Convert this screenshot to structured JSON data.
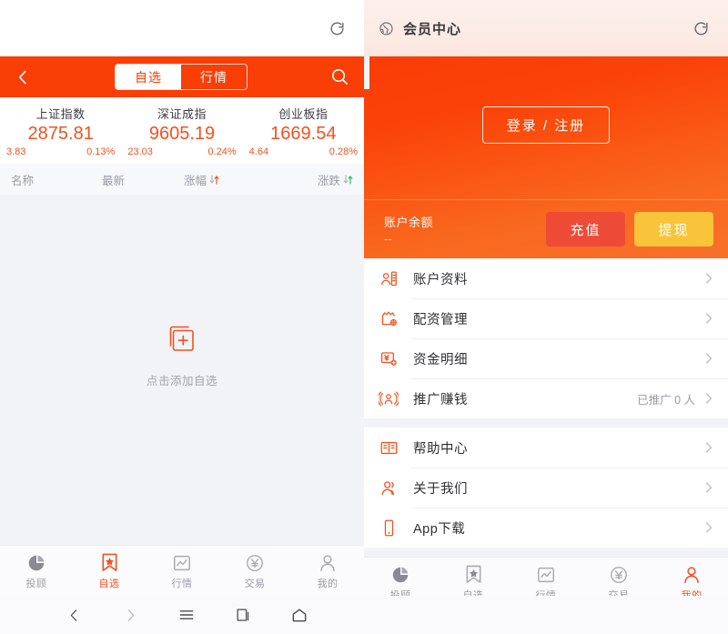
{
  "browser": {
    "left": {
      "reload_icon": "reload-icon"
    },
    "right": {
      "globe_icon": "globe-icon",
      "title": "会员中心",
      "reload_icon": "reload-icon"
    }
  },
  "left_app": {
    "header": {
      "back_icon": "chevron-left-icon",
      "search_icon": "search-icon",
      "tabs": [
        {
          "label": "自选",
          "active": true
        },
        {
          "label": "行情",
          "active": false
        }
      ]
    },
    "indices": [
      {
        "name": "上证指数",
        "value": "2875.81",
        "change": "3.83",
        "percent": "0.13%"
      },
      {
        "name": "深证成指",
        "value": "9605.19",
        "change": "23.03",
        "percent": "0.24%"
      },
      {
        "name": "创业板指",
        "value": "1669.54",
        "change": "4.64",
        "percent": "0.28%"
      }
    ],
    "table_headers": [
      {
        "label": "名称",
        "sort_icon": ""
      },
      {
        "label": "最新",
        "sort_icon": ""
      },
      {
        "label": "涨幅",
        "sort_icon": "sort-arrows-icon",
        "accent": "#f4511e"
      },
      {
        "label": "涨跌",
        "sort_icon": "sort-arrows-icon",
        "accent": "#2fbf63"
      }
    ],
    "empty_state": {
      "icon": "add-document-icon",
      "text": "点击添加自选"
    }
  },
  "right_app": {
    "hero": {
      "login_button": "登录 / 注册"
    },
    "balance": {
      "label": "账户余额",
      "value": "--",
      "recharge_button": "充值",
      "withdraw_button": "提现"
    },
    "menu_groups": [
      {
        "items": [
          {
            "icon": "account-card-icon",
            "label": "账户资料",
            "extra": ""
          },
          {
            "icon": "funding-settings-icon",
            "label": "配资管理",
            "extra": ""
          },
          {
            "icon": "funds-detail-icon",
            "label": "资金明细",
            "extra": ""
          },
          {
            "icon": "promote-icon",
            "label": "推广赚钱",
            "extra": "已推广 0 人"
          }
        ]
      },
      {
        "items": [
          {
            "icon": "help-book-icon",
            "label": "帮助中心",
            "extra": ""
          },
          {
            "icon": "about-us-icon",
            "label": "关于我们",
            "extra": ""
          },
          {
            "icon": "phone-icon",
            "label": "App下载",
            "extra": ""
          }
        ]
      }
    ]
  },
  "tabbars": {
    "left": [
      {
        "icon": "pie-chart-icon",
        "label": "投顾",
        "active": false
      },
      {
        "icon": "bookmark-star-icon",
        "label": "自选",
        "active": true
      },
      {
        "icon": "quote-chart-icon",
        "label": "行情",
        "active": false
      },
      {
        "icon": "yuan-circle-icon",
        "label": "交易",
        "active": false
      },
      {
        "icon": "person-icon",
        "label": "我的",
        "active": false
      }
    ],
    "right": [
      {
        "icon": "pie-chart-icon",
        "label": "投顾",
        "active": false
      },
      {
        "icon": "bookmark-star-icon",
        "label": "自选",
        "active": false
      },
      {
        "icon": "quote-chart-icon",
        "label": "行情",
        "active": false
      },
      {
        "icon": "yuan-circle-icon",
        "label": "交易",
        "active": false
      },
      {
        "icon": "person-icon",
        "label": "我的",
        "active": true
      }
    ]
  },
  "system_nav": [
    {
      "icon": "nav-back-icon"
    },
    {
      "icon": "nav-forward-icon"
    },
    {
      "icon": "nav-menu-icon"
    },
    {
      "icon": "nav-tabs-icon"
    },
    {
      "icon": "nav-home-icon"
    }
  ],
  "colors": {
    "brand_orange": "#f93e06",
    "accent_orange": "#f4511e",
    "recharge_red": "#ee4b36",
    "withdraw_yellow": "#f9c43a",
    "up_green": "#2fbf63",
    "muted_text": "#9b9ba6",
    "page_bg": "#f2f3f7"
  }
}
